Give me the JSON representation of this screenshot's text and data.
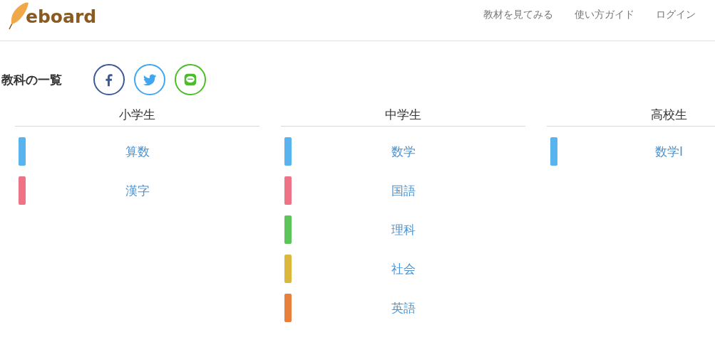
{
  "logo": {
    "text": "eboard"
  },
  "nav": [
    "教材を見てみる",
    "使い方ガイド",
    "ログイン"
  ],
  "section_title": "教科の一覧",
  "share": [
    {
      "kind": "facebook"
    },
    {
      "kind": "twitter"
    },
    {
      "kind": "line"
    }
  ],
  "columns": [
    {
      "title": "小学生",
      "subjects": [
        {
          "label": "算数",
          "color": "#58b3ef"
        },
        {
          "label": "漢字",
          "color": "#ee7386"
        }
      ]
    },
    {
      "title": "中学生",
      "subjects": [
        {
          "label": "数学",
          "color": "#58b3ef"
        },
        {
          "label": "国語",
          "color": "#ee7386"
        },
        {
          "label": "理科",
          "color": "#5cc55a"
        },
        {
          "label": "社会",
          "color": "#dbb83b"
        },
        {
          "label": "英語",
          "color": "#e8803b"
        }
      ]
    },
    {
      "title": "高校生",
      "subjects": [
        {
          "label": "数学I",
          "color": "#58b3ef"
        }
      ]
    }
  ]
}
